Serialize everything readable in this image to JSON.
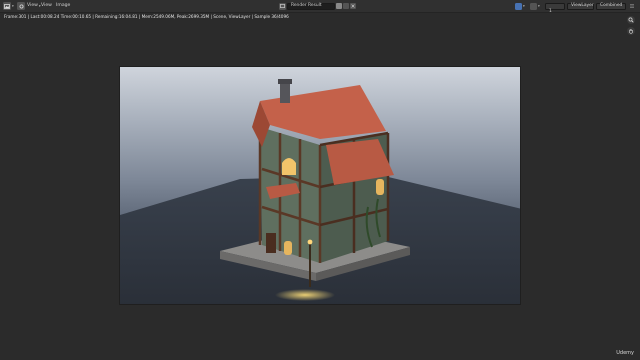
{
  "header": {
    "menu": {
      "view": "View",
      "view2": "View",
      "image": "Image"
    },
    "image_name": "Render Result",
    "slot": "Slot 1",
    "view_layer": "ViewLayer",
    "pass": "Combined"
  },
  "stats": "Frame:301 | Last:00:08.24 Time:00:10.65 | Remaining:16:04.81 | Mem:2549.06M, Peak:2699.35M | Scene, ViewLayer | Sample 36/4096",
  "watermark": "Udemy",
  "icons": {
    "editor_type": "image-editor-icon",
    "zoom": "zoom-icon",
    "pan": "hand-icon",
    "close": "close-icon"
  },
  "colors": {
    "accent": "#4772b3",
    "background": "#2b2b2b",
    "header": "#303030"
  }
}
